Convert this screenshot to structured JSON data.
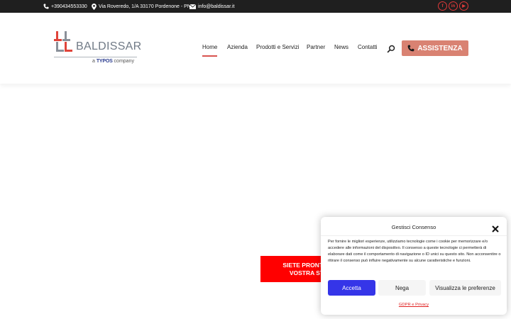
{
  "topbar": {
    "phone": "+390434553330",
    "address": "Via Roveredo, 1/A 33170 Pordenone - PN",
    "email": "info@baldissar.it",
    "social": [
      {
        "icon": "facebook-icon",
        "glyph": "f"
      },
      {
        "icon": "linkedin-icon",
        "glyph": "in"
      },
      {
        "icon": "youtube-icon",
        "glyph": "▶"
      }
    ]
  },
  "logo": {
    "name": "BALDISSAR",
    "sub_prefix": "a",
    "sub_brand": "TYPOS",
    "sub_suffix": "company"
  },
  "nav": {
    "items": [
      "Home",
      "Azienda",
      "Prodotti e Servizi",
      "Partner",
      "News",
      "Contatti"
    ],
    "active": "Home",
    "assist_label": "ASSISTENZA"
  },
  "banner": {
    "line1": "SIETE PRONTI A",
    "line2": "VOSTRA ST"
  },
  "consent": {
    "title": "Gestisci Consenso",
    "body": "Per fornire le migliori esperienze, utilizziamo tecnologie come i cookie per memorizzare e/o accedere alle informazioni del dispositivo. Il consenso a queste tecnologie ci permetterà di elaborare dati come il comportamento di navigazione o ID unici su questo sito. Non acconsentire o ritirare il consenso può influire negativamente su alcune caratteristiche e funzioni.",
    "accept": "Accetta",
    "deny": "Nega",
    "preferences": "Visualizza le preferenze",
    "link": "GDPR e Privacy"
  },
  "colors": {
    "topbar_bg": "#1f1f1f",
    "accent_red": "#d9534f",
    "assist_bg": "#d98272",
    "banner_red": "#ff0000",
    "accept_blue": "#3535e8"
  }
}
